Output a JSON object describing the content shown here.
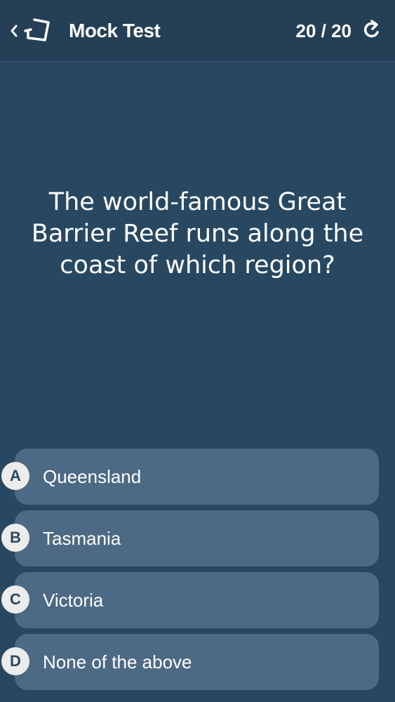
{
  "header": {
    "title": "Mock Test",
    "progress": "20 / 20",
    "icons": {
      "back": "chevron-left-icon",
      "logo": "quiz-card-icon",
      "refresh": "refresh-icon"
    }
  },
  "question": {
    "text": "The world-famous Great Barrier Reef runs along the coast of which region?"
  },
  "answers": [
    {
      "letter": "A",
      "label": "Queensland"
    },
    {
      "letter": "B",
      "label": "Tasmania"
    },
    {
      "letter": "C",
      "label": "Victoria"
    },
    {
      "letter": "D",
      "label": "None of the above"
    }
  ],
  "colors": {
    "background": "#284862",
    "header": "#243f56",
    "answer_bg": "#4d6a84",
    "badge_bg": "#ececec",
    "text": "#ffffff"
  }
}
